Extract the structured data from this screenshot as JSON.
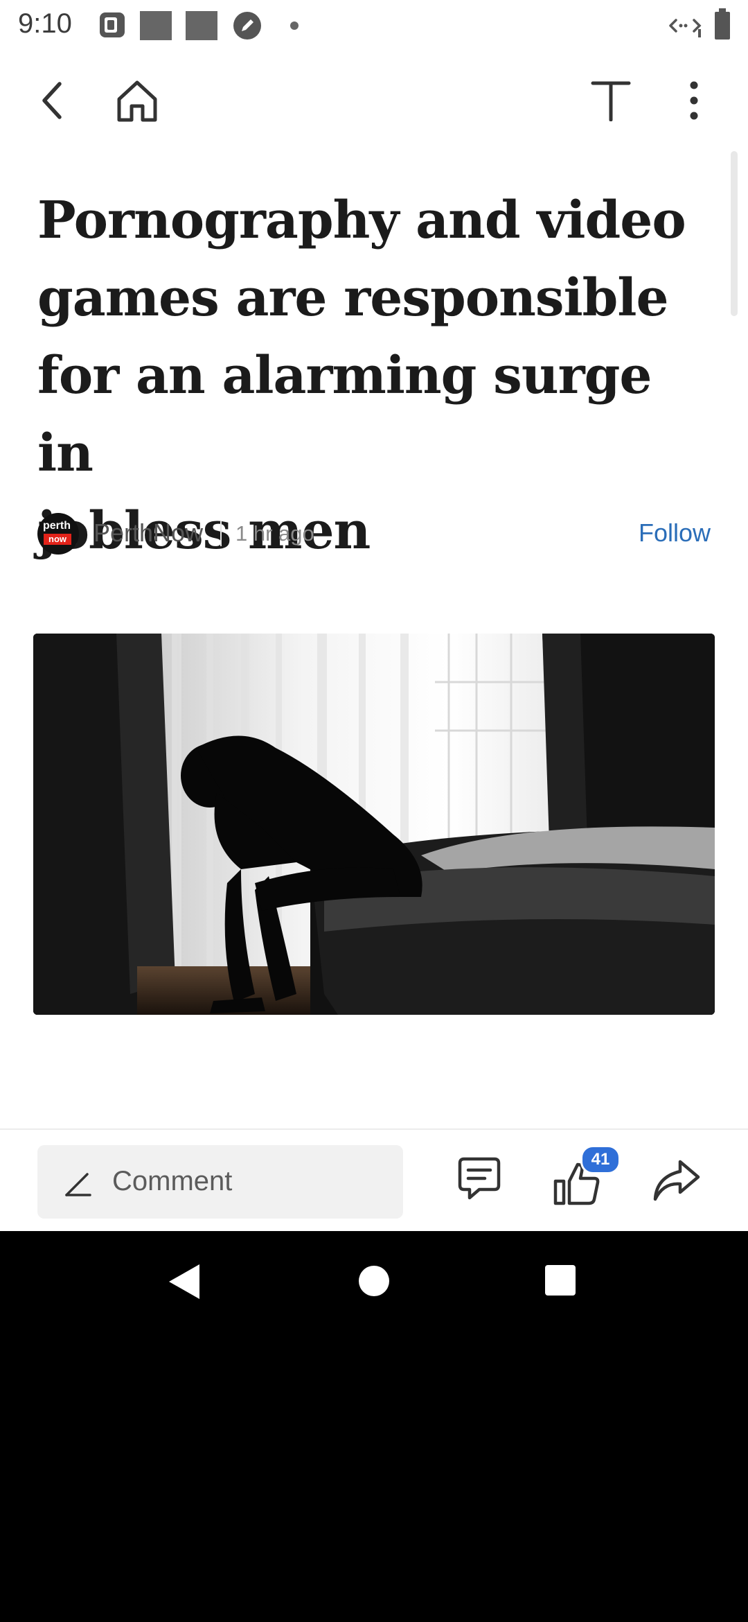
{
  "status_bar": {
    "time": "9:10"
  },
  "toolbar": {
    "back_icon": "chevron-left-icon",
    "home_icon": "home-icon",
    "text_size_icon": "text-size-icon",
    "more_icon": "more-vertical-icon"
  },
  "article": {
    "headline_lines": [
      "Pornography and video",
      "games are responsible",
      "for an alarming surge in",
      "jobless men"
    ],
    "source": {
      "logo_top": "perth",
      "logo_bottom": "now",
      "name": "PerthNow",
      "time_ago": "1 hr ago",
      "follow_label": "Follow"
    }
  },
  "action_bar": {
    "comment_placeholder": "Comment",
    "like_count": "41"
  },
  "colors": {
    "accent_blue": "#2a6db8",
    "badge_blue": "#2f6fd8",
    "logo_red": "#e2231a"
  }
}
